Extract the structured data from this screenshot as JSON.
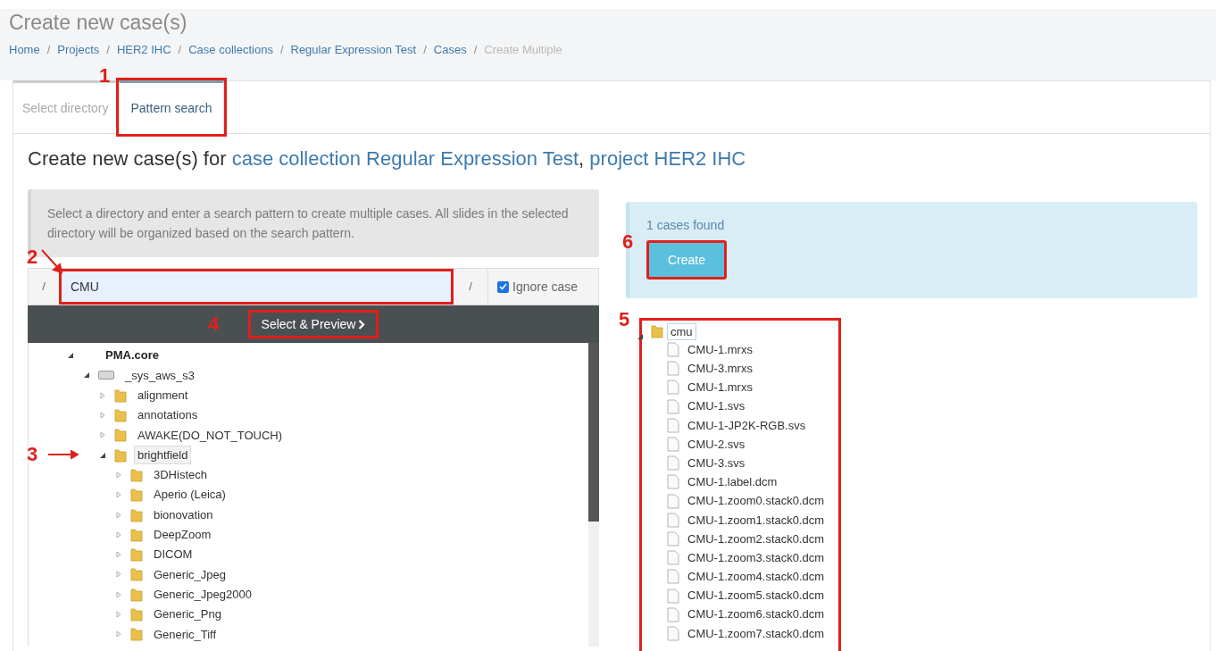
{
  "page": {
    "title": "Create new case(s)"
  },
  "breadcrumb_separator": "/",
  "breadcrumb": [
    {
      "label": "Home",
      "link": true
    },
    {
      "label": "Projects",
      "link": true
    },
    {
      "label": "HER2 IHC",
      "link": true
    },
    {
      "label": "Case collections",
      "link": true
    },
    {
      "label": "Regular Expression Test",
      "link": true
    },
    {
      "label": "Cases",
      "link": true
    },
    {
      "label": "Create Multiple",
      "link": false
    }
  ],
  "tabs": [
    {
      "label": "Select directory",
      "selected": false
    },
    {
      "label": "Pattern search",
      "selected": true
    }
  ],
  "heading": [
    {
      "text": "Create new case(s) for ",
      "kind": "plain"
    },
    {
      "text": "case collection Regular Expression Test",
      "kind": "link"
    },
    {
      "text": ", ",
      "kind": "plain"
    },
    {
      "text": "project HER2 IHC",
      "kind": "link"
    }
  ],
  "info": "Select a directory and enter a search pattern to create multiple cases. All slides in the selected directory will be organized based on the search pattern.",
  "pattern": {
    "prefix": "/",
    "value": "CMU",
    "suffix": "/",
    "ignore_case": {
      "label": "Ignore case",
      "checked": true
    }
  },
  "preview_button": "Select & Preview",
  "tree": [
    {
      "label": "PMA.core",
      "kind": "root",
      "expanded": true,
      "selected": false,
      "children": [
        {
          "label": "_sys_aws_s3",
          "kind": "drive",
          "expanded": true,
          "selected": false,
          "children": [
            {
              "label": "alignment",
              "kind": "folder",
              "expanded": false,
              "selected": false
            },
            {
              "label": "annotations",
              "kind": "folder",
              "expanded": false,
              "selected": false
            },
            {
              "label": "AWAKE(DO_NOT_TOUCH)",
              "kind": "folder",
              "expanded": false,
              "selected": false
            },
            {
              "label": "brightfield",
              "kind": "folder",
              "expanded": true,
              "selected": true,
              "children": [
                {
                  "label": "3DHistech",
                  "kind": "folder",
                  "expanded": false,
                  "selected": false
                },
                {
                  "label": "Aperio (Leica)",
                  "kind": "folder",
                  "expanded": false,
                  "selected": false
                },
                {
                  "label": "bionovation",
                  "kind": "folder",
                  "expanded": false,
                  "selected": false
                },
                {
                  "label": "DeepZoom",
                  "kind": "folder",
                  "expanded": false,
                  "selected": false
                },
                {
                  "label": "DICOM",
                  "kind": "folder",
                  "expanded": false,
                  "selected": false
                },
                {
                  "label": "Generic_Jpeg",
                  "kind": "folder",
                  "expanded": false,
                  "selected": false
                },
                {
                  "label": "Generic_Jpeg2000",
                  "kind": "folder",
                  "expanded": false,
                  "selected": false
                },
                {
                  "label": "Generic_Png",
                  "kind": "folder",
                  "expanded": false,
                  "selected": false
                },
                {
                  "label": "Generic_Tiff",
                  "kind": "folder",
                  "expanded": false,
                  "selected": false
                }
              ]
            }
          ]
        }
      ]
    }
  ],
  "result": {
    "message": "1 cases found",
    "button": "Create"
  },
  "files": {
    "folder": "cmu",
    "expanded": true,
    "children": [
      "CMU-1.mrxs",
      "CMU-3.mrxs",
      "CMU-1.mrxs",
      "CMU-1.svs",
      "CMU-1-JP2K-RGB.svs",
      "CMU-2.svs",
      "CMU-3.svs",
      "CMU-1.label.dcm",
      "CMU-1.zoom0.stack0.dcm",
      "CMU-1.zoom1.stack0.dcm",
      "CMU-1.zoom2.stack0.dcm",
      "CMU-1.zoom3.stack0.dcm",
      "CMU-1.zoom4.stack0.dcm",
      "CMU-1.zoom5.stack0.dcm",
      "CMU-1.zoom6.stack0.dcm",
      "CMU-1.zoom7.stack0.dcm"
    ]
  },
  "annotations": [
    "1",
    "2",
    "3",
    "4",
    "5",
    "6"
  ]
}
